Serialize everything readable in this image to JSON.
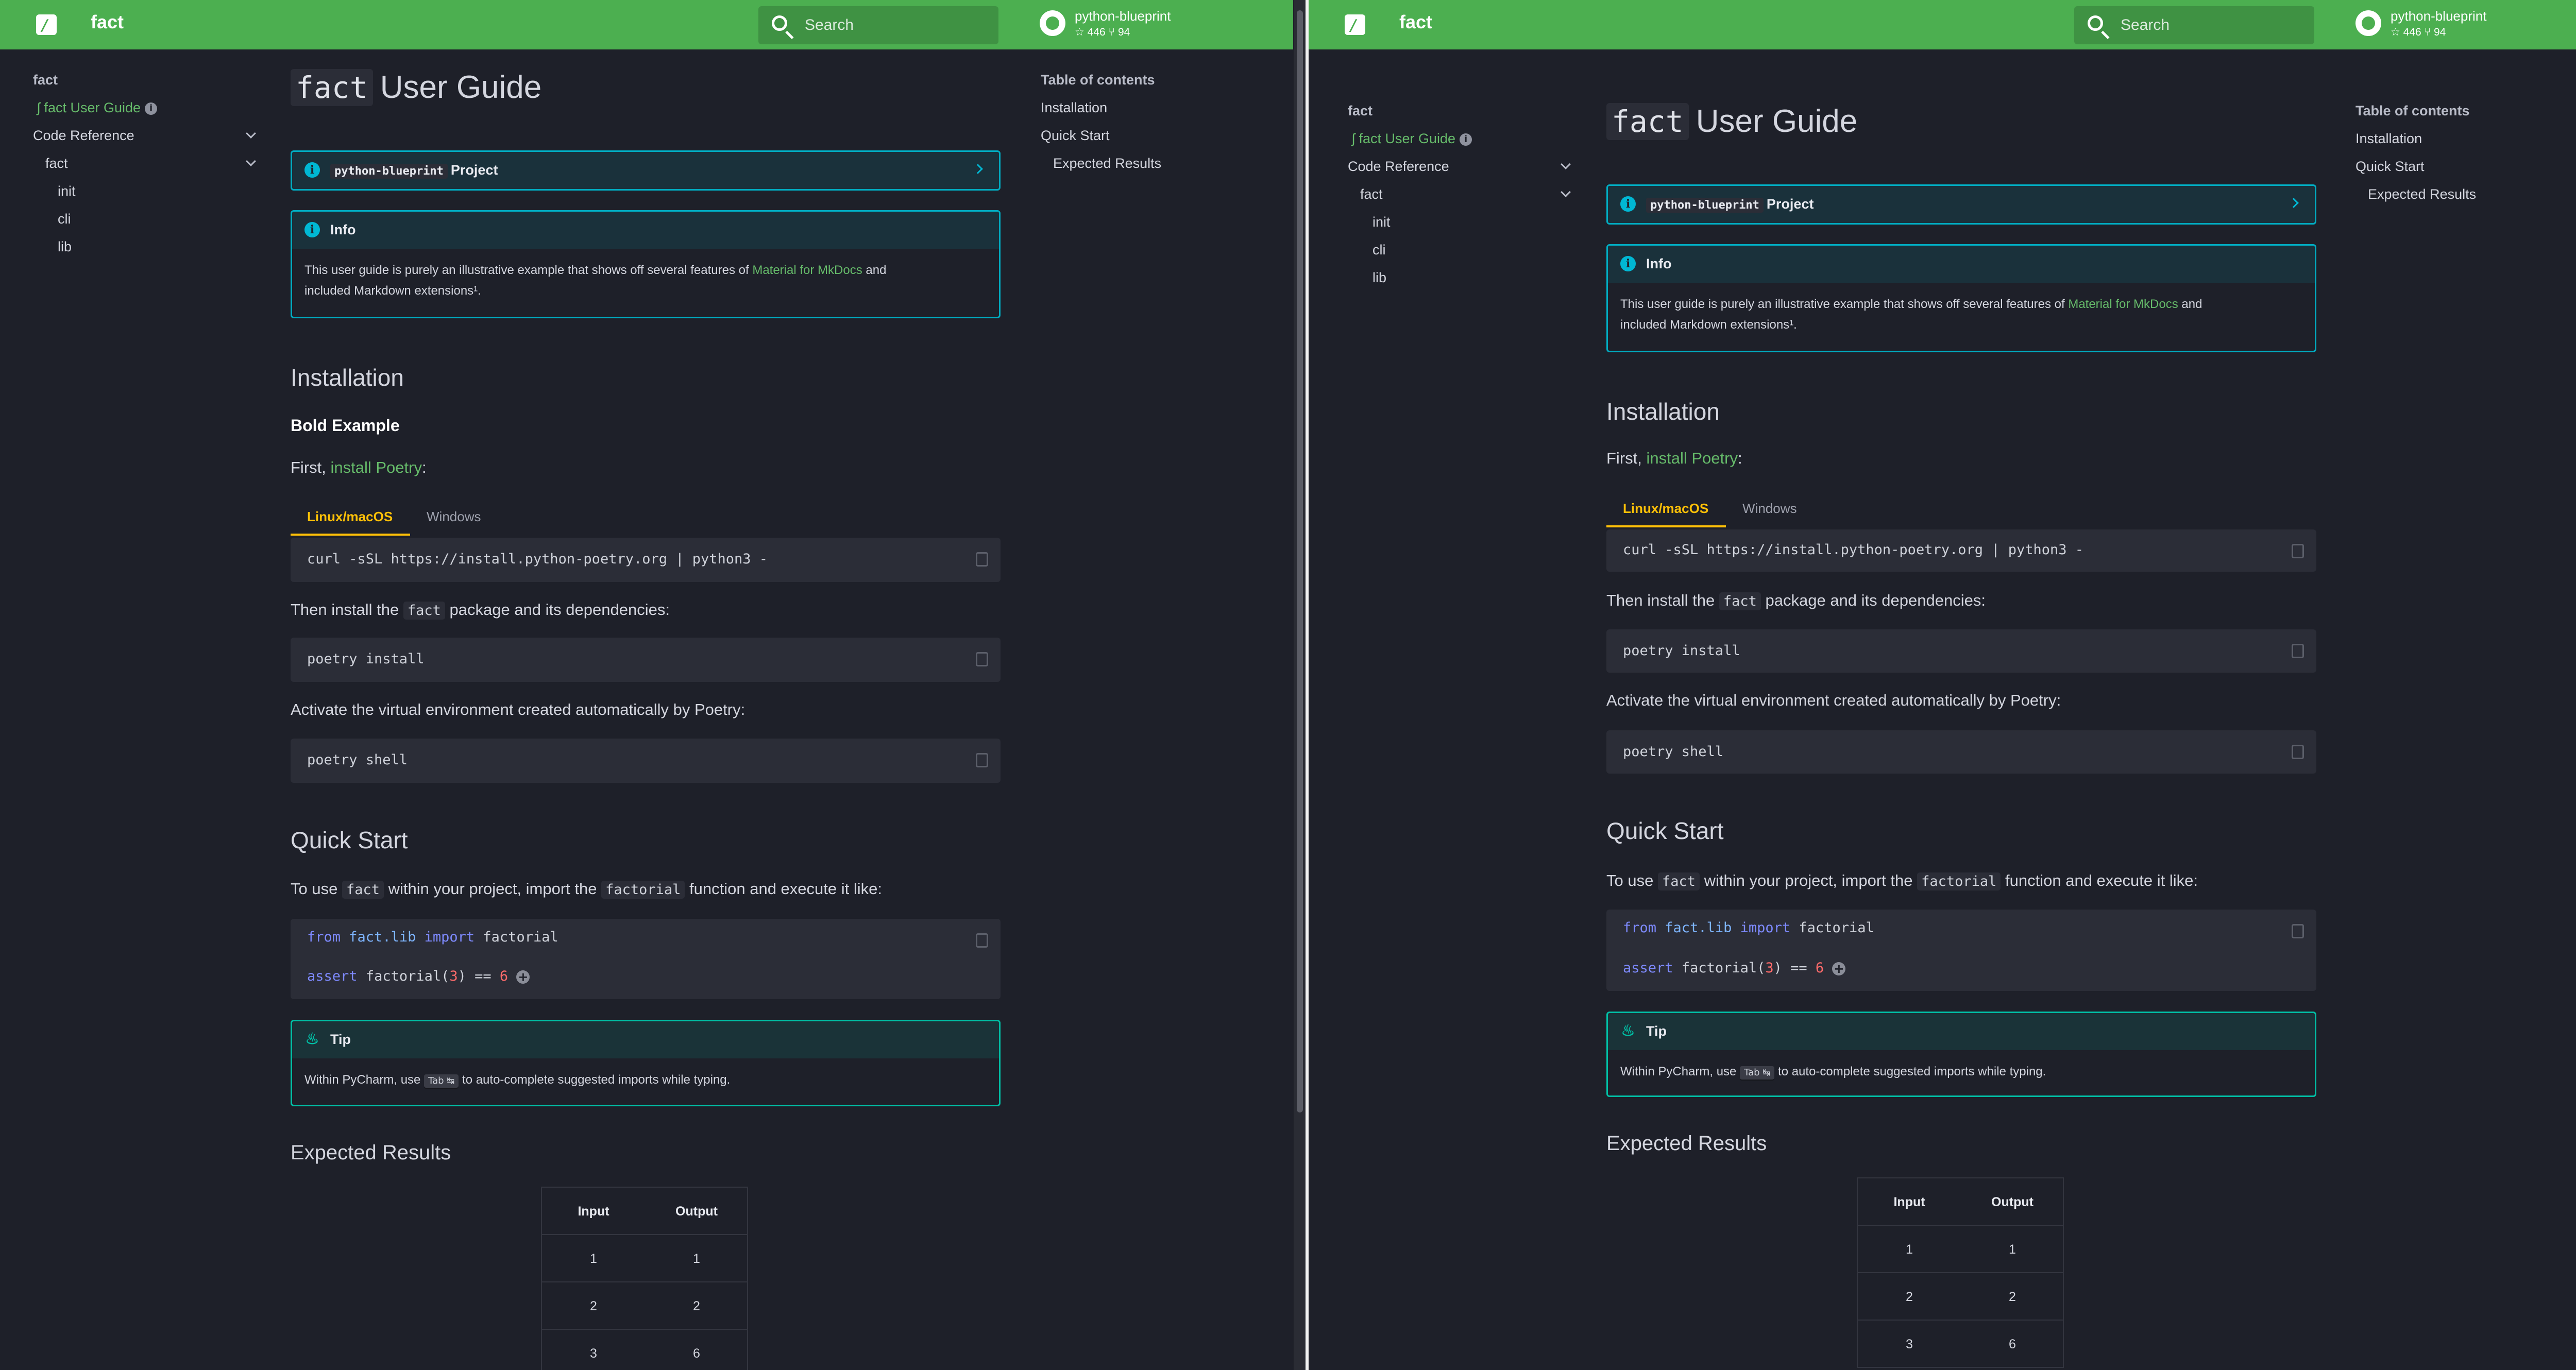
{
  "header": {
    "logo_glyph": "/",
    "site_name": "fact",
    "search_placeholder": "Search",
    "repo_name": "python-blueprint",
    "repo_stats": "☆ 446   ⑂ 94"
  },
  "nav": {
    "title": "fact",
    "items": [
      {
        "label": "ʃ  fact User Guide"
      },
      {
        "label": "Code Reference"
      },
      {
        "label": "fact"
      },
      {
        "label": "init"
      },
      {
        "label": "cli"
      },
      {
        "label": "lib"
      }
    ]
  },
  "toc": {
    "title": "Table of contents",
    "items": [
      "Installation",
      "Quick Start",
      "Expected Results"
    ]
  },
  "content": {
    "title_code": "fact",
    "title_text": "User Guide",
    "project_admon": {
      "code": "python-blueprint",
      "text": "Project"
    },
    "info_admon": {
      "title": "Info",
      "body_prefix": "This user guide is purely an illustrative example that shows off several features of ",
      "body_link": "Material for MkDocs",
      "body_suffix": " and",
      "body_line2": "included Markdown extensions¹."
    },
    "installation_heading": "Installation",
    "bold_example": "Bold Example",
    "first_prefix": "First, ",
    "first_link": "install Poetry",
    "first_suffix": ":",
    "tabs": [
      "Linux/macOS",
      "Windows"
    ],
    "code_curl": "curl -sSL https://install.python-poetry.org | python3 -",
    "then_prefix": "Then install the ",
    "then_code": "fact",
    "then_suffix": " package and its dependencies:",
    "code_install": "poetry install",
    "activate_text": "Activate the virtual environment created automatically by Poetry:",
    "code_shell": "poetry shell",
    "quickstart_heading": "Quick Start",
    "qs_1": "To use ",
    "qs_code1": "fact",
    "qs_2": " within your project, import the ",
    "qs_code2": "factorial",
    "qs_3": " function and execute it like:",
    "code_line1": {
      "kw1": "from",
      "mod": "fact.lib",
      "kw2": "import",
      "name": "factorial"
    },
    "code_line2": {
      "kw": "assert",
      "fn": "factorial(",
      "num1": "3",
      "close": ") == ",
      "num2": "6",
      "annot": "+"
    },
    "tip_admon": {
      "title": "Tip",
      "body_prefix": "Within PyCharm, use ",
      "kbd": "Tab ↹",
      "body_suffix": " to auto-complete suggested imports while typing."
    },
    "expected_heading": "Expected Results",
    "table": {
      "headers": [
        "Input",
        "Output"
      ],
      "rows": [
        [
          "1",
          "1"
        ],
        [
          "2",
          "2"
        ],
        [
          "3",
          "6"
        ]
      ]
    }
  }
}
